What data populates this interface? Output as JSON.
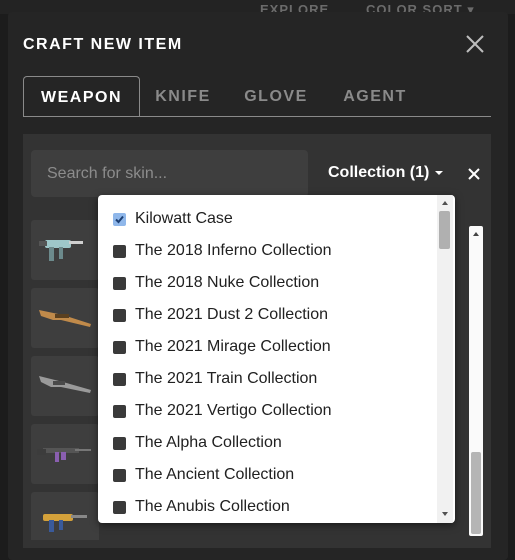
{
  "background": {
    "nav_items": [
      "EXPLORE",
      "COLOR SORT ▾"
    ]
  },
  "modal": {
    "title": "CRAFT NEW ITEM",
    "close_icon": "close-icon"
  },
  "tabs": [
    {
      "label": "WEAPON",
      "active": true
    },
    {
      "label": "KNIFE",
      "active": false
    },
    {
      "label": "GLOVE",
      "active": false
    },
    {
      "label": "AGENT",
      "active": false
    }
  ],
  "search": {
    "placeholder": "Search for skin...",
    "value": ""
  },
  "collection_filter": {
    "label": "Collection (1)",
    "clear_icon": "close-icon"
  },
  "dropdown": {
    "options": [
      {
        "label": "Kilowatt Case",
        "checked": true
      },
      {
        "label": "The 2018 Inferno Collection",
        "checked": false
      },
      {
        "label": "The 2018 Nuke Collection",
        "checked": false
      },
      {
        "label": "The 2021 Dust 2 Collection",
        "checked": false
      },
      {
        "label": "The 2021 Mirage Collection",
        "checked": false
      },
      {
        "label": "The 2021 Train Collection",
        "checked": false
      },
      {
        "label": "The 2021 Vertigo Collection",
        "checked": false
      },
      {
        "label": "The Alpha Collection",
        "checked": false
      },
      {
        "label": "The Ancient Collection",
        "checked": false
      },
      {
        "label": "The Anubis Collection",
        "checked": false
      }
    ]
  },
  "weapon_cards": [
    {
      "icon": "smg-skin-icon",
      "accent": "#9ec7c9"
    },
    {
      "icon": "shotgun-skin-icon",
      "accent": "#c08a4a"
    },
    {
      "icon": "shotgun-skin-icon",
      "accent": "#9a9a9a"
    },
    {
      "icon": "rifle-skin-icon",
      "accent": "#8a5fb0"
    },
    {
      "icon": "smg-skin-icon",
      "accent": "#d4a13a"
    }
  ],
  "colors": {
    "modal_bg": "#252525",
    "content_bg": "#333333",
    "checkbox_checked": "#8fb7ea",
    "checkbox_unchecked": "#3a3a3a"
  }
}
